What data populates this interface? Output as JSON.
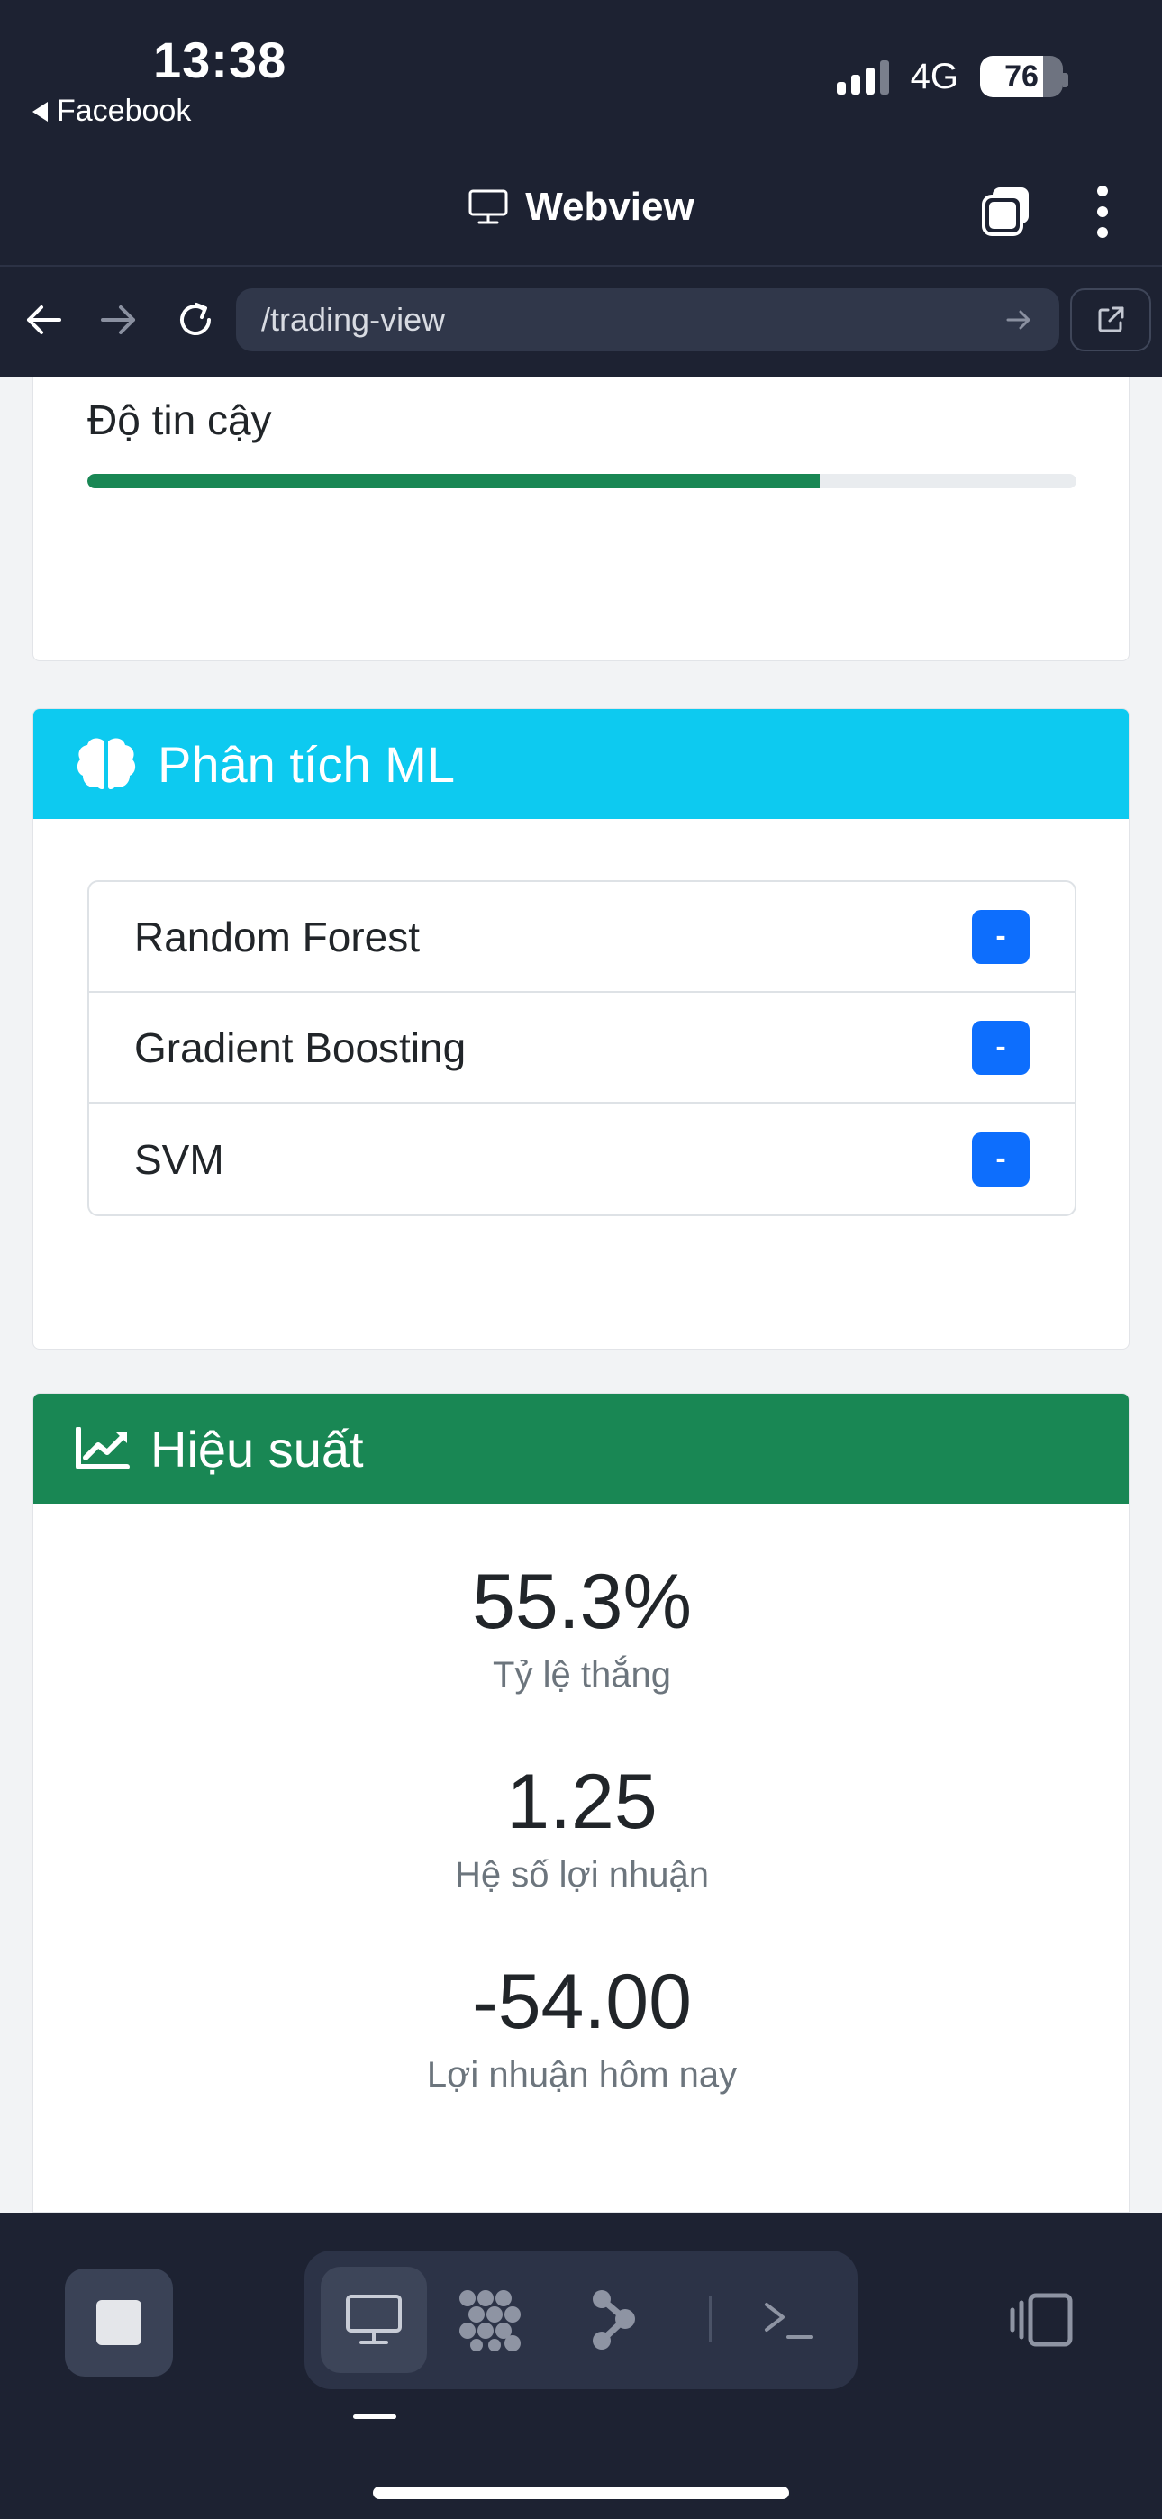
{
  "status_bar": {
    "time": "13:38",
    "back_app": "Facebook",
    "network": "4G",
    "battery": "76",
    "battery_level": 0.76
  },
  "browser": {
    "title": "Webview",
    "url": "/trading-view"
  },
  "confidence": {
    "label": "Độ tin cậy",
    "value": 0.74
  },
  "ml": {
    "title": "Phân tích ML",
    "items": [
      {
        "name": "Random Forest",
        "badge": "-"
      },
      {
        "name": "Gradient Boosting",
        "badge": "-"
      },
      {
        "name": "SVM",
        "badge": "-"
      }
    ]
  },
  "performance": {
    "title": "Hiệu suất",
    "stats": [
      {
        "value": "55.3%",
        "label": "Tỷ lệ thắng"
      },
      {
        "value": "1.25",
        "label": "Hệ số lợi nhuận"
      },
      {
        "value": "-54.00",
        "label": "Lợi nhuận hôm nay"
      }
    ]
  },
  "colors": {
    "chrome_bg": "#1d2232",
    "ml_header": "#0dcaf0",
    "perf_header": "#198754",
    "badge": "#0d6efd",
    "progress": "#198754",
    "danger": "#dc3545"
  },
  "toolbar": {
    "icons": [
      "stop-icon",
      "monitor-icon",
      "grid-dots-icon",
      "graph-icon",
      "terminal-icon",
      "device-layout-icon"
    ]
  }
}
